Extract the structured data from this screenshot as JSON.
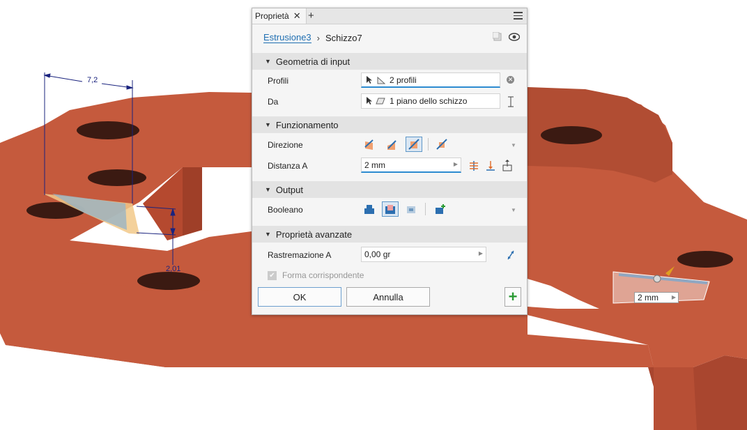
{
  "panel": {
    "tab_title": "Proprietà",
    "close_glyph": "✕",
    "add_glyph": "+",
    "breadcrumb": {
      "feature": "Estrusione3",
      "separator": "›",
      "sketch": "Schizzo7"
    }
  },
  "sections": {
    "input_geometry": {
      "title": "Geometria di input",
      "profiles_label": "Profili",
      "profiles_value": "2 profili",
      "from_label": "Da",
      "from_value": "1 piano dello schizzo"
    },
    "behavior": {
      "title": "Funzionamento",
      "direction_label": "Direzione",
      "distance_label": "Distanza A",
      "distance_value": "2 mm"
    },
    "output": {
      "title": "Output",
      "boolean_label": "Booleano"
    },
    "advanced": {
      "title": "Proprietà avanzate",
      "taper_label": "Rastremazione A",
      "taper_value": "0,00 gr",
      "match_shape_label": "Forma corrispondente",
      "match_shape_checked": true
    }
  },
  "buttons": {
    "ok": "OK",
    "cancel": "Annulla",
    "apply": "+"
  },
  "viewport": {
    "dim_width": "7,2",
    "dim_height": "2,01",
    "extent_input": "2 mm"
  },
  "colors": {
    "model": "#c55a3d",
    "accent": "#2c8bd0",
    "sketch": "#1a237e",
    "apply": "#2a9a33"
  },
  "icons": [
    "pointer-icon",
    "profile-icon",
    "plane-icon",
    "flip-icon",
    "direction-icon",
    "join-icon",
    "cut-icon",
    "intersect-icon",
    "new-solid-icon",
    "eye-icon",
    "menu-icon"
  ]
}
